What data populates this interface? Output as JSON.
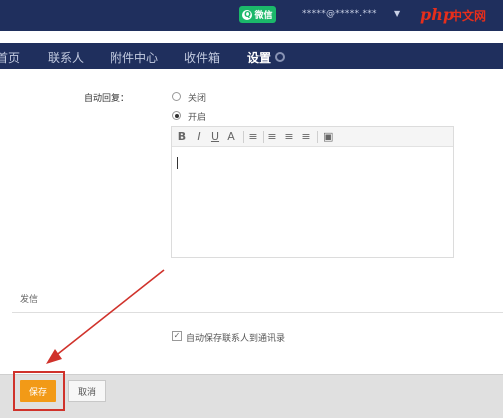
{
  "header": {
    "wechat_label": "微信",
    "account_email": "*****@*****.***",
    "logo": {
      "php": "php",
      "cn": "中文网"
    }
  },
  "nav": {
    "items": [
      "首页",
      "联系人",
      "附件中心",
      "收件箱",
      "设置"
    ],
    "active": "设置"
  },
  "settings": {
    "auto_reply_label": "自动回复：",
    "options": [
      {
        "label": "关闭",
        "checked": false
      },
      {
        "label": "开启",
        "checked": true
      }
    ],
    "editor_toolbar": [
      "B",
      "I",
      "U",
      "A",
      "≡",
      "≡",
      "≡",
      "≡",
      "▣"
    ]
  },
  "send_section": {
    "tab_label": "发信",
    "save_contacts_label": "自动保存联系人到通讯录",
    "save_contacts_checked": true
  },
  "footer": {
    "save_label": "保存",
    "cancel_label": "取消"
  },
  "colors": {
    "header_bg": "#1f2f5d",
    "accent": "#f29a17",
    "annotation": "#d0322b"
  }
}
